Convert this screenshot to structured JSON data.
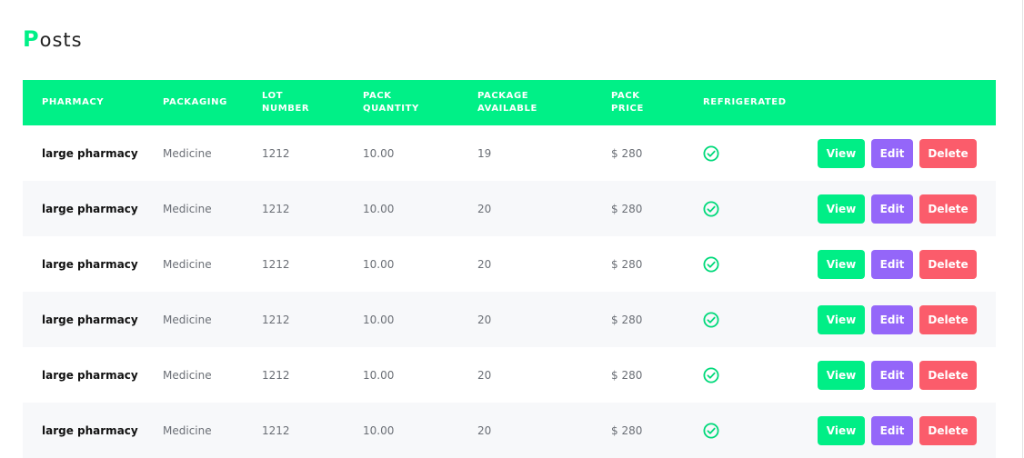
{
  "title": {
    "first_letter": "P",
    "rest": "osts"
  },
  "colors": {
    "accent": "#00f087",
    "view": "#00ee86",
    "edit": "#9466f9",
    "delete": "#fb5c6b",
    "row_alt": "#f7f8fa"
  },
  "table": {
    "columns": [
      "PHARMACY",
      "PACKAGING",
      "LOT\nNUMBER",
      "PACK\nQUANTITY",
      "PACKAGE\nAVAILABLE",
      "PACK\nPRICE",
      "REFRIGERATED"
    ],
    "rows": [
      {
        "pharmacy": "large pharmacy",
        "packaging": "Medicine",
        "lot_number": "1212",
        "pack_quantity": "10.00",
        "package_available": "19",
        "pack_price": "$ 280",
        "refrigerated_icon": "check-circle-icon",
        "view": "View",
        "edit": "Edit",
        "delete": "Delete"
      },
      {
        "pharmacy": "large pharmacy",
        "packaging": "Medicine",
        "lot_number": "1212",
        "pack_quantity": "10.00",
        "package_available": "20",
        "pack_price": "$ 280",
        "refrigerated_icon": "check-circle-icon",
        "view": "View",
        "edit": "Edit",
        "delete": "Delete"
      },
      {
        "pharmacy": "large pharmacy",
        "packaging": "Medicine",
        "lot_number": "1212",
        "pack_quantity": "10.00",
        "package_available": "20",
        "pack_price": "$ 280",
        "refrigerated_icon": "check-circle-icon",
        "view": "View",
        "edit": "Edit",
        "delete": "Delete"
      },
      {
        "pharmacy": "large pharmacy",
        "packaging": "Medicine",
        "lot_number": "1212",
        "pack_quantity": "10.00",
        "package_available": "20",
        "pack_price": "$ 280",
        "refrigerated_icon": "check-circle-icon",
        "view": "View",
        "edit": "Edit",
        "delete": "Delete"
      },
      {
        "pharmacy": "large pharmacy",
        "packaging": "Medicine",
        "lot_number": "1212",
        "pack_quantity": "10.00",
        "package_available": "20",
        "pack_price": "$ 280",
        "refrigerated_icon": "check-circle-icon",
        "view": "View",
        "edit": "Edit",
        "delete": "Delete"
      },
      {
        "pharmacy": "large pharmacy",
        "packaging": "Medicine",
        "lot_number": "1212",
        "pack_quantity": "10.00",
        "package_available": "20",
        "pack_price": "$ 280",
        "refrigerated_icon": "check-circle-icon",
        "view": "View",
        "edit": "Edit",
        "delete": "Delete"
      }
    ]
  }
}
